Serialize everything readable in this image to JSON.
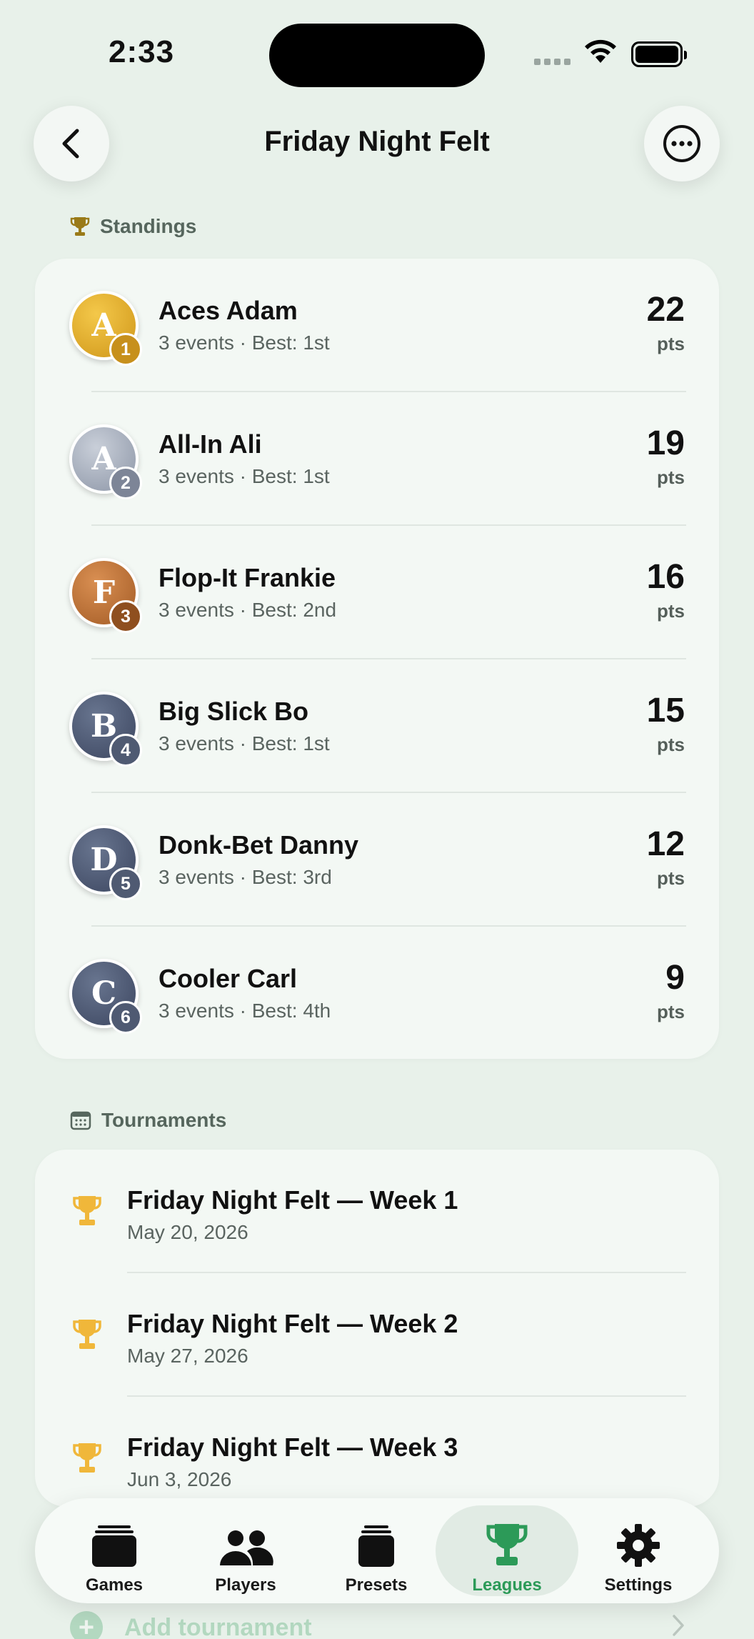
{
  "status_bar": {
    "time": "2:33"
  },
  "nav": {
    "title": "Friday Night Felt"
  },
  "standings": {
    "header": "Standings",
    "rows": [
      {
        "initial": "A",
        "rank": "1",
        "name": "Aces Adam",
        "meta": "3 events  ·  Best: 1st",
        "points": "22",
        "unit": "pts"
      },
      {
        "initial": "A",
        "rank": "2",
        "name": "All-In Ali",
        "meta": "3 events  ·  Best: 1st",
        "points": "19",
        "unit": "pts"
      },
      {
        "initial": "F",
        "rank": "3",
        "name": "Flop-It Frankie",
        "meta": "3 events  ·  Best: 2nd",
        "points": "16",
        "unit": "pts"
      },
      {
        "initial": "B",
        "rank": "4",
        "name": "Big Slick Bo",
        "meta": "3 events  ·  Best: 1st",
        "points": "15",
        "unit": "pts"
      },
      {
        "initial": "D",
        "rank": "5",
        "name": "Donk-Bet Danny",
        "meta": "3 events  ·  Best: 3rd",
        "points": "12",
        "unit": "pts"
      },
      {
        "initial": "C",
        "rank": "6",
        "name": "Cooler Carl",
        "meta": "3 events  ·  Best: 4th",
        "points": "9",
        "unit": "pts"
      }
    ]
  },
  "tournaments": {
    "header": "Tournaments",
    "items": [
      {
        "name": "Friday Night Felt — Week 1",
        "date": "May 20, 2026"
      },
      {
        "name": "Friday Night Felt — Week 2",
        "date": "May 27, 2026"
      },
      {
        "name": "Friday Night Felt — Week 3",
        "date": "Jun 3, 2026"
      }
    ],
    "add_label": "Add tournament"
  },
  "tab_bar": {
    "tabs": [
      {
        "label": "Games"
      },
      {
        "label": "Players"
      },
      {
        "label": "Presets"
      },
      {
        "label": "Leagues"
      },
      {
        "label": "Settings"
      }
    ],
    "active": "Leagues"
  },
  "colors": {
    "accent": "#2c9a58",
    "gold": "#d9a22a",
    "silver": "#a4abb8",
    "bronze": "#b36a32",
    "slate": "#4a5670",
    "trophy": "#f0b73a",
    "background": "#e8f1ea"
  },
  "icons": {
    "back": "chevron-left-icon",
    "more": "ellipsis-circle-icon",
    "standings": "trophy-icon",
    "tournaments": "calendar-icon"
  }
}
